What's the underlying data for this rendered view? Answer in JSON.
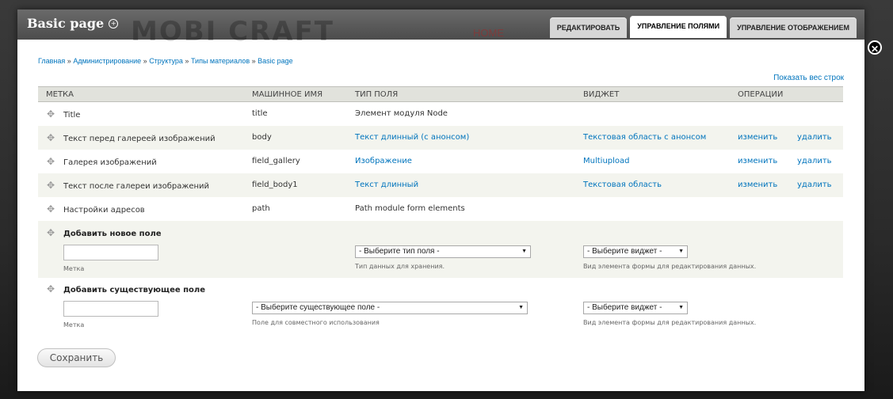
{
  "modal": {
    "title": "Basic page",
    "watermark": "MOBI CRAFT",
    "watermark_home": "HOME",
    "close_glyph": "✕"
  },
  "tabs": [
    {
      "label": "РЕДАКТИРОВАТЬ",
      "active": false
    },
    {
      "label": "УПРАВЛЕНИЕ ПОЛЯМИ",
      "active": true
    },
    {
      "label": "УПРАВЛЕНИЕ ОТОБРАЖЕНИЕМ",
      "active": false
    }
  ],
  "breadcrumb": {
    "items": [
      "Главная",
      "Администрирование",
      "Структура",
      "Типы материалов",
      "Basic page"
    ],
    "separator": "»"
  },
  "show_weights": "Показать вес строк",
  "table": {
    "headers": [
      "МЕТКА",
      "МАШИННОЕ ИМЯ",
      "ТИП ПОЛЯ",
      "ВИДЖЕТ",
      "ОПЕРАЦИИ"
    ],
    "rows": [
      {
        "label": "Title",
        "machine": "title",
        "type": "Элемент модуля Node",
        "widget": "",
        "edit": "",
        "delete": ""
      },
      {
        "label": "Текст перед галереей изображений",
        "machine": "body",
        "type": "Текст длинный (с анонсом)",
        "widget": "Текстовая область с анонсом",
        "edit": "изменить",
        "delete": "удалить"
      },
      {
        "label": "Галерея изображений",
        "machine": "field_gallery",
        "type": "Изображение",
        "widget": "Multiupload",
        "edit": "изменить",
        "delete": "удалить"
      },
      {
        "label": "Текст после галереи изображений",
        "machine": "field_body1",
        "type": "Текст длинный",
        "widget": "Текстовая область",
        "edit": "изменить",
        "delete": "удалить"
      },
      {
        "label": "Настройки адресов",
        "machine": "path",
        "type": "Path module form elements",
        "widget": "",
        "edit": "",
        "delete": ""
      }
    ],
    "add_new": {
      "title": "Добавить новое поле",
      "label_value": "",
      "label_hint": "Метка",
      "type_select": "- Выберите тип поля -",
      "type_hint": "Тип данных для хранения.",
      "widget_select": "- Выберите виджет -",
      "widget_hint": "Вид элемента формы для редактирования данных."
    },
    "add_existing": {
      "title": "Добавить существующее поле",
      "label_value": "",
      "label_hint": "Метка",
      "field_select": "- Выберите существующее поле -",
      "field_hint": "Поле для совместного использования",
      "widget_select": "- Выберите виджет -",
      "widget_hint": "Вид элемента формы для редактирования данных."
    }
  },
  "save_label": "Сохранить",
  "icons": {
    "drag": "move-handle-icon",
    "dropdown": "chevron-down-icon",
    "close": "close-icon",
    "title": "plus-circle-icon"
  },
  "colors": {
    "link": "#0074bd",
    "header_bg": "#e1e2dc",
    "even_row": "#f3f4ee"
  }
}
